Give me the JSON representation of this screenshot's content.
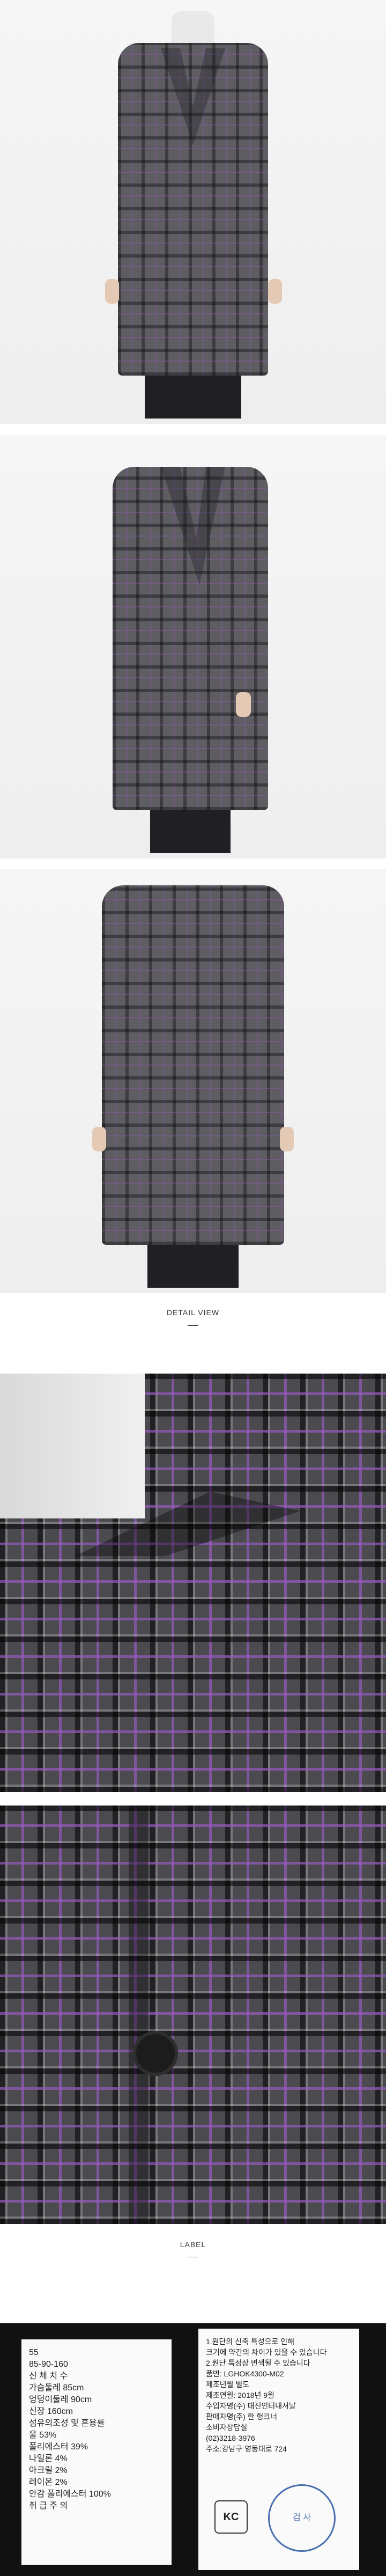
{
  "product": {
    "name": "plaid check wool coat",
    "colors": {
      "check_gray": "#5d5d62",
      "purple_stripe": "#8c5aaa",
      "background": "#f4f4f4"
    }
  },
  "sections": {
    "detail_title": "DETAIL VIEW",
    "label_title": "LABEL"
  },
  "label_tag": {
    "size": "55",
    "measure": "85-90-160",
    "size_heading": "신 체 치 수",
    "rows": [
      {
        "name": "가슴둘레",
        "value": "85cm"
      },
      {
        "name": "엉덩이둘레",
        "value": "90cm"
      },
      {
        "name": "신장",
        "value": "160cm"
      }
    ],
    "fiber_heading": "섬유의조성 및 혼용률",
    "fibers": [
      {
        "name": "울",
        "value": "53%"
      },
      {
        "name": "폴리에스터",
        "value": "39%"
      },
      {
        "name": "나일론",
        "value": "4%"
      },
      {
        "name": "아크릴",
        "value": "2%"
      },
      {
        "name": "레이온",
        "value": "2%"
      },
      {
        "name": "안감 폴리에스터",
        "value": "100%"
      }
    ],
    "care_heading": "취 급 주 의"
  },
  "info_tag": {
    "lines": [
      "1.원단의 신축 특성으로 인해",
      "크기에 약간의 차이가 있을 수 있습니다",
      "2.원단 특성상 변색될 수 있습니다",
      "품번: LGHOK4300-M02",
      "제조년월 별도",
      "제조연월: 2018년 9월",
      "수입자명(주) 태진인터내셔날",
      "판매자명(주) 한 헝크너",
      "소비자상담실",
      "(02)3218-3976",
      "주소:강남구 영동대로 724"
    ],
    "kc_mark": "KC",
    "stamp_text": "검 사"
  }
}
